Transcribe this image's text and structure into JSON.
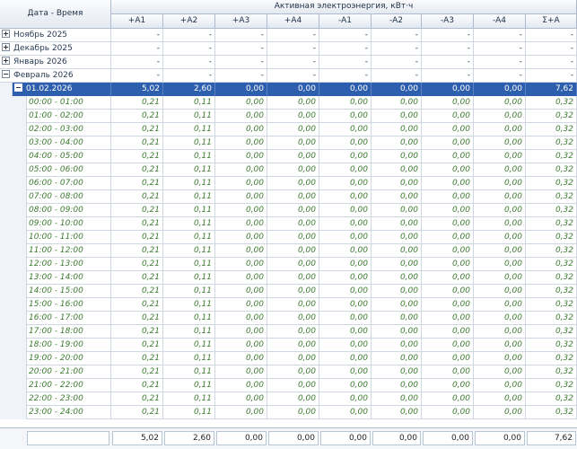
{
  "header": {
    "date_time": "Дата - Время",
    "group_title": "Активная электроэнергия, кВт·ч",
    "columns": [
      "+A1",
      "+A2",
      "+A3",
      "+A4",
      "-A1",
      "-A2",
      "-A3",
      "-A4",
      "Σ+A"
    ]
  },
  "groups": [
    {
      "label": "Ноябрь 2025",
      "values": [
        "-",
        "-",
        "-",
        "-",
        "-",
        "-",
        "-",
        "-",
        "-"
      ]
    },
    {
      "label": "Декабрь 2025",
      "values": [
        "-",
        "-",
        "-",
        "-",
        "-",
        "-",
        "-",
        "-",
        "-"
      ]
    },
    {
      "label": "Январь 2026",
      "values": [
        "-",
        "-",
        "-",
        "-",
        "-",
        "-",
        "-",
        "-",
        "-"
      ]
    },
    {
      "label": "Февраль 2026",
      "values": [
        "-",
        "-",
        "-",
        "-",
        "-",
        "-",
        "-",
        "-",
        "-"
      ]
    }
  ],
  "day": {
    "label": "01.02.2026",
    "values": [
      "5,02",
      "2,60",
      "0,00",
      "0,00",
      "0,00",
      "0,00",
      "0,00",
      "0,00",
      "7,62"
    ]
  },
  "hours": [
    {
      "label": "00:00 - 01:00",
      "values": [
        "0,21",
        "0,11",
        "0,00",
        "0,00",
        "0,00",
        "0,00",
        "0,00",
        "0,00",
        "0,32"
      ]
    },
    {
      "label": "01:00 - 02:00",
      "values": [
        "0,21",
        "0,11",
        "0,00",
        "0,00",
        "0,00",
        "0,00",
        "0,00",
        "0,00",
        "0,32"
      ]
    },
    {
      "label": "02:00 - 03:00",
      "values": [
        "0,21",
        "0,11",
        "0,00",
        "0,00",
        "0,00",
        "0,00",
        "0,00",
        "0,00",
        "0,32"
      ]
    },
    {
      "label": "03:00 - 04:00",
      "values": [
        "0,21",
        "0,11",
        "0,00",
        "0,00",
        "0,00",
        "0,00",
        "0,00",
        "0,00",
        "0,32"
      ]
    },
    {
      "label": "04:00 - 05:00",
      "values": [
        "0,21",
        "0,11",
        "0,00",
        "0,00",
        "0,00",
        "0,00",
        "0,00",
        "0,00",
        "0,32"
      ]
    },
    {
      "label": "05:00 - 06:00",
      "values": [
        "0,21",
        "0,11",
        "0,00",
        "0,00",
        "0,00",
        "0,00",
        "0,00",
        "0,00",
        "0,32"
      ]
    },
    {
      "label": "06:00 - 07:00",
      "values": [
        "0,21",
        "0,11",
        "0,00",
        "0,00",
        "0,00",
        "0,00",
        "0,00",
        "0,00",
        "0,32"
      ]
    },
    {
      "label": "07:00 - 08:00",
      "values": [
        "0,21",
        "0,11",
        "0,00",
        "0,00",
        "0,00",
        "0,00",
        "0,00",
        "0,00",
        "0,32"
      ]
    },
    {
      "label": "08:00 - 09:00",
      "values": [
        "0,21",
        "0,11",
        "0,00",
        "0,00",
        "0,00",
        "0,00",
        "0,00",
        "0,00",
        "0,32"
      ]
    },
    {
      "label": "09:00 - 10:00",
      "values": [
        "0,21",
        "0,11",
        "0,00",
        "0,00",
        "0,00",
        "0,00",
        "0,00",
        "0,00",
        "0,32"
      ]
    },
    {
      "label": "10:00 - 11:00",
      "values": [
        "0,21",
        "0,11",
        "0,00",
        "0,00",
        "0,00",
        "0,00",
        "0,00",
        "0,00",
        "0,32"
      ]
    },
    {
      "label": "11:00 - 12:00",
      "values": [
        "0,21",
        "0,11",
        "0,00",
        "0,00",
        "0,00",
        "0,00",
        "0,00",
        "0,00",
        "0,32"
      ]
    },
    {
      "label": "12:00 - 13:00",
      "values": [
        "0,21",
        "0,11",
        "0,00",
        "0,00",
        "0,00",
        "0,00",
        "0,00",
        "0,00",
        "0,32"
      ]
    },
    {
      "label": "13:00 - 14:00",
      "values": [
        "0,21",
        "0,11",
        "0,00",
        "0,00",
        "0,00",
        "0,00",
        "0,00",
        "0,00",
        "0,32"
      ]
    },
    {
      "label": "14:00 - 15:00",
      "values": [
        "0,21",
        "0,11",
        "0,00",
        "0,00",
        "0,00",
        "0,00",
        "0,00",
        "0,00",
        "0,32"
      ]
    },
    {
      "label": "15:00 - 16:00",
      "values": [
        "0,21",
        "0,11",
        "0,00",
        "0,00",
        "0,00",
        "0,00",
        "0,00",
        "0,00",
        "0,32"
      ]
    },
    {
      "label": "16:00 - 17:00",
      "values": [
        "0,21",
        "0,11",
        "0,00",
        "0,00",
        "0,00",
        "0,00",
        "0,00",
        "0,00",
        "0,32"
      ]
    },
    {
      "label": "17:00 - 18:00",
      "values": [
        "0,21",
        "0,11",
        "0,00",
        "0,00",
        "0,00",
        "0,00",
        "0,00",
        "0,00",
        "0,32"
      ]
    },
    {
      "label": "18:00 - 19:00",
      "values": [
        "0,21",
        "0,11",
        "0,00",
        "0,00",
        "0,00",
        "0,00",
        "0,00",
        "0,00",
        "0,32"
      ]
    },
    {
      "label": "19:00 - 20:00",
      "values": [
        "0,21",
        "0,11",
        "0,00",
        "0,00",
        "0,00",
        "0,00",
        "0,00",
        "0,00",
        "0,32"
      ]
    },
    {
      "label": "20:00 - 21:00",
      "values": [
        "0,21",
        "0,11",
        "0,00",
        "0,00",
        "0,00",
        "0,00",
        "0,00",
        "0,00",
        "0,32"
      ]
    },
    {
      "label": "21:00 - 22:00",
      "values": [
        "0,21",
        "0,11",
        "0,00",
        "0,00",
        "0,00",
        "0,00",
        "0,00",
        "0,00",
        "0,32"
      ]
    },
    {
      "label": "22:00 - 23:00",
      "values": [
        "0,21",
        "0,11",
        "0,00",
        "0,00",
        "0,00",
        "0,00",
        "0,00",
        "0,00",
        "0,32"
      ]
    },
    {
      "label": "23:00 - 24:00",
      "values": [
        "0,21",
        "0,11",
        "0,00",
        "0,00",
        "0,00",
        "0,00",
        "0,00",
        "0,00",
        "0,32"
      ]
    }
  ],
  "totals": [
    "5,02",
    "2,60",
    "0,00",
    "0,00",
    "0,00",
    "0,00",
    "0,00",
    "0,00",
    "7,62"
  ],
  "colors": {
    "day_row_bg": "#2d5fae",
    "hour_text": "#3d7a31",
    "header_text": "#1e2f45"
  }
}
